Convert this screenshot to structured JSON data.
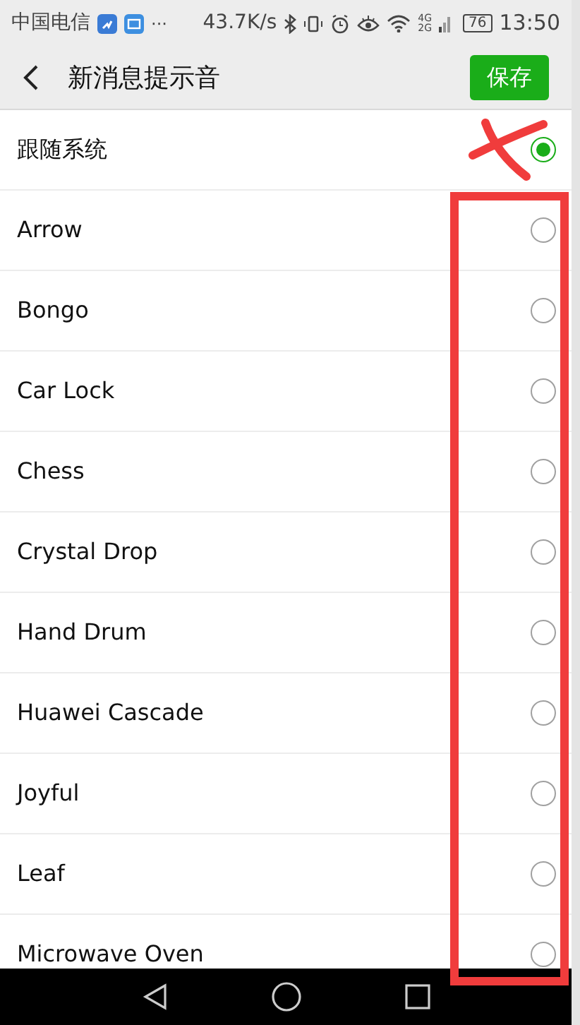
{
  "status_bar": {
    "carrier": "中国电信",
    "more": "···",
    "speed": "43.7K/s",
    "network": [
      "4G",
      "2G"
    ],
    "battery": "76",
    "time": "13:50"
  },
  "header": {
    "title": "新消息提示音",
    "save_button": "保存"
  },
  "options": [
    {
      "label": "跟随系统",
      "selected": true
    },
    {
      "label": "Arrow",
      "selected": false
    },
    {
      "label": "Bongo",
      "selected": false
    },
    {
      "label": "Car Lock",
      "selected": false
    },
    {
      "label": "Chess",
      "selected": false
    },
    {
      "label": "Crystal Drop",
      "selected": false
    },
    {
      "label": "Hand Drum",
      "selected": false
    },
    {
      "label": "Huawei Cascade",
      "selected": false
    },
    {
      "label": "Joyful",
      "selected": false
    },
    {
      "label": "Leaf",
      "selected": false
    },
    {
      "label": "Microwave Oven",
      "selected": false
    }
  ]
}
